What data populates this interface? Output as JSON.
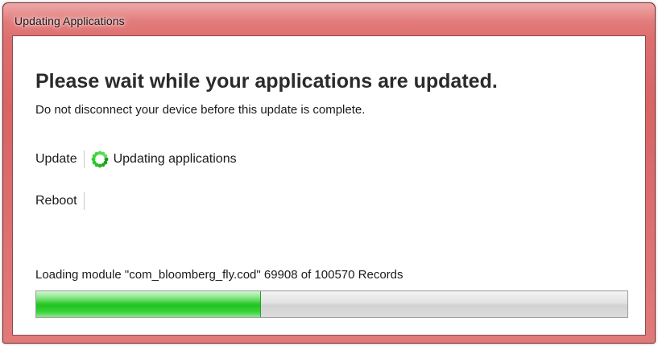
{
  "window": {
    "title": "Updating Applications"
  },
  "main": {
    "heading": "Please wait while your applications are updated.",
    "subheading": "Do not disconnect your device before this update is complete."
  },
  "steps": [
    {
      "label": "Update",
      "status": "Updating applications",
      "icon": "spinner-icon"
    },
    {
      "label": "Reboot",
      "status": ""
    }
  ],
  "progress": {
    "text": "Loading module \"com_bloomberg_fly.cod\" 69908 of 100570 Records",
    "current": 69908,
    "total": 100570,
    "fraction": 0.38,
    "color": "#1fc41f"
  },
  "colors": {
    "titlebar": "#d96464",
    "spinner": "#2aa82a"
  }
}
